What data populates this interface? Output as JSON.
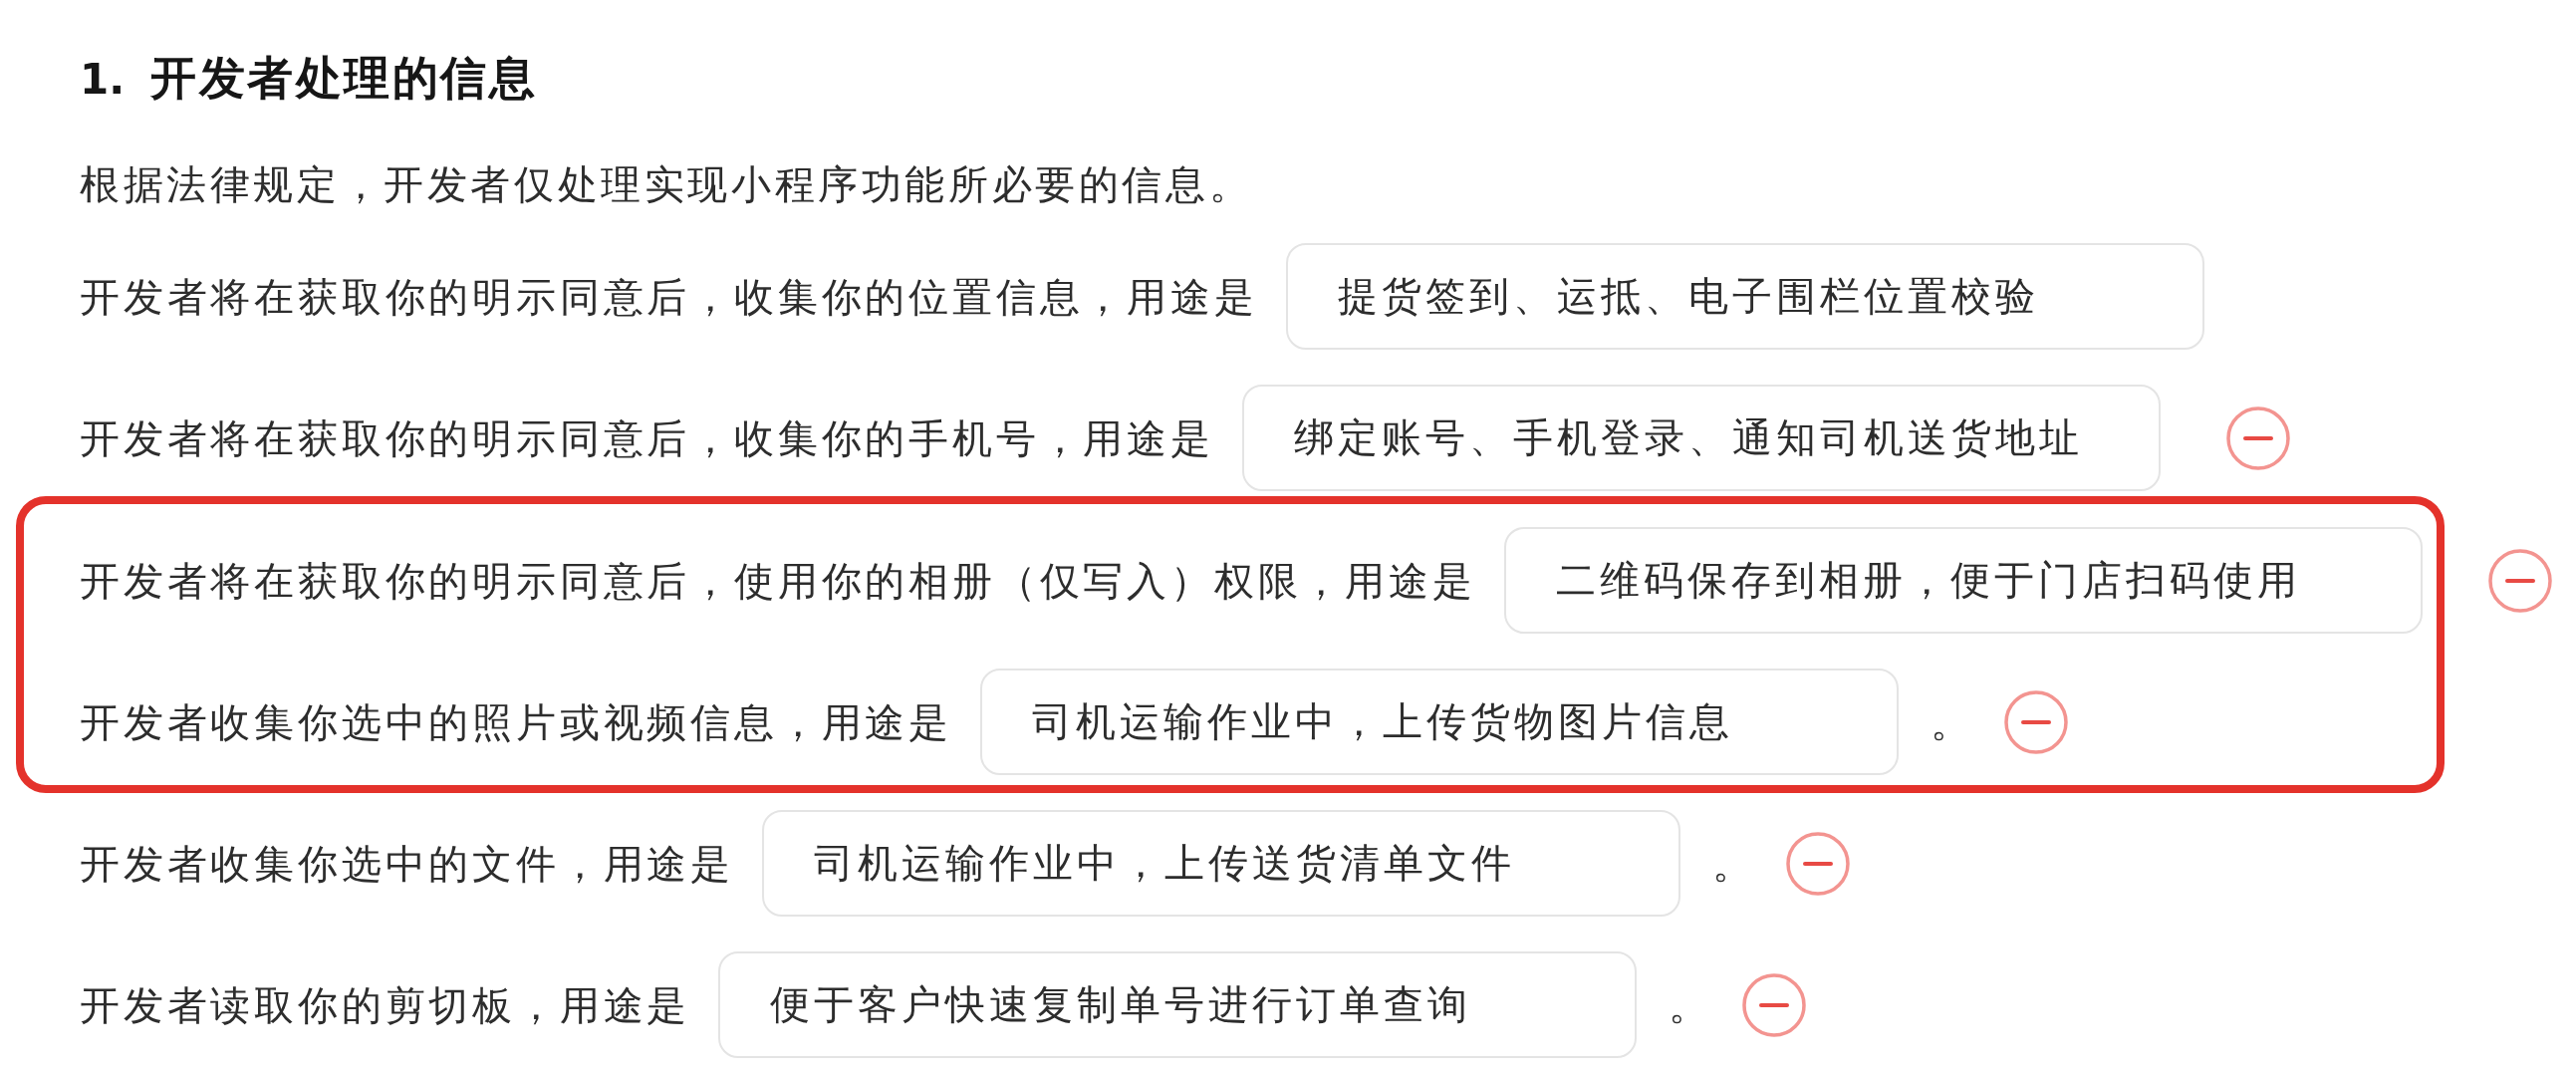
{
  "section": {
    "number": "1.",
    "title": "开发者处理的信息"
  },
  "intro": "根据法律规定，开发者仅处理实现小程序功能所必要的信息。",
  "items": [
    {
      "statement": "开发者将在获取你的明示同意后，收集你的位置信息，用途是",
      "purpose": "提货签到、运抵、电子围栏位置校验",
      "removable": false,
      "highlighted": false
    },
    {
      "statement": "开发者将在获取你的明示同意后，收集你的手机号，用途是",
      "purpose": "绑定账号、手机登录、通知司机送货地址",
      "removable": true,
      "highlighted": false
    },
    {
      "statement": "开发者将在获取你的明示同意后，使用你的相册（仅写入）权限，用途是",
      "purpose": "二维码保存到相册，便于门店扫码使用",
      "removable": true,
      "highlighted": true
    },
    {
      "statement": "开发者收集你选中的照片或视频信息，用途是",
      "purpose": "司机运输作业中，上传货物图片信息",
      "ending": "。",
      "removable": true,
      "highlighted": true
    },
    {
      "statement": "开发者收集你选中的文件，用途是",
      "purpose": "司机运输作业中，上传送货清单文件",
      "ending": "。",
      "removable": true,
      "highlighted": false
    },
    {
      "statement": "开发者读取你的剪切板，用途是",
      "purpose": "便于客户快速复制单号进行订单查询",
      "ending": "。",
      "removable": true,
      "highlighted": false
    }
  ]
}
